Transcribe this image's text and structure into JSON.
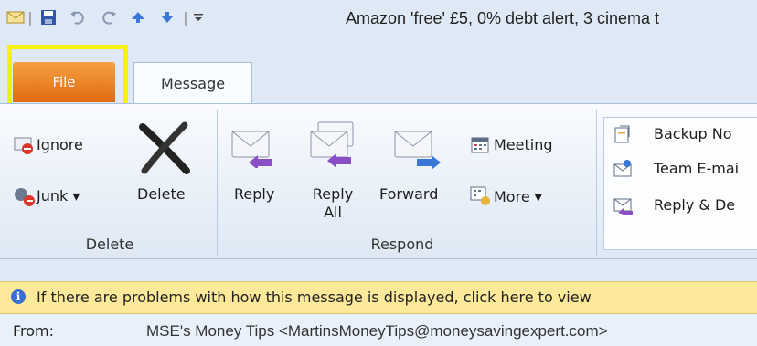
{
  "quick_access": {
    "title": "Amazon 'free' £5, 0% debt alert, 3 cinema t",
    "icons": [
      "envelope-icon",
      "save-icon",
      "undo-icon",
      "redo-icon",
      "up-arrow-icon",
      "down-arrow-icon",
      "customize-icon"
    ]
  },
  "tabs": {
    "file": "File",
    "message": "Message"
  },
  "ribbon": {
    "delete_group": {
      "label": "Delete",
      "ignore": "Ignore",
      "junk": "Junk",
      "delete": "Delete"
    },
    "respond_group": {
      "label": "Respond",
      "reply": "Reply",
      "reply_all_line1": "Reply",
      "reply_all_line2": "All",
      "forward": "Forward",
      "meeting": "Meeting",
      "more": "More"
    },
    "quick_steps": {
      "backup": "Backup No",
      "team_email": "Team E-mai",
      "reply_delete": "Reply & De"
    }
  },
  "infobar": {
    "text": "If there are problems with how this message is displayed, click here to view"
  },
  "header": {
    "from_label": "From:",
    "from_value": "MSE's Money Tips <MartinsMoneyTips@moneysavingexpert.com>"
  },
  "colors": {
    "file_tab": "#e87a1e",
    "highlight": "#f6f20a",
    "infobar": "#fde99a"
  }
}
